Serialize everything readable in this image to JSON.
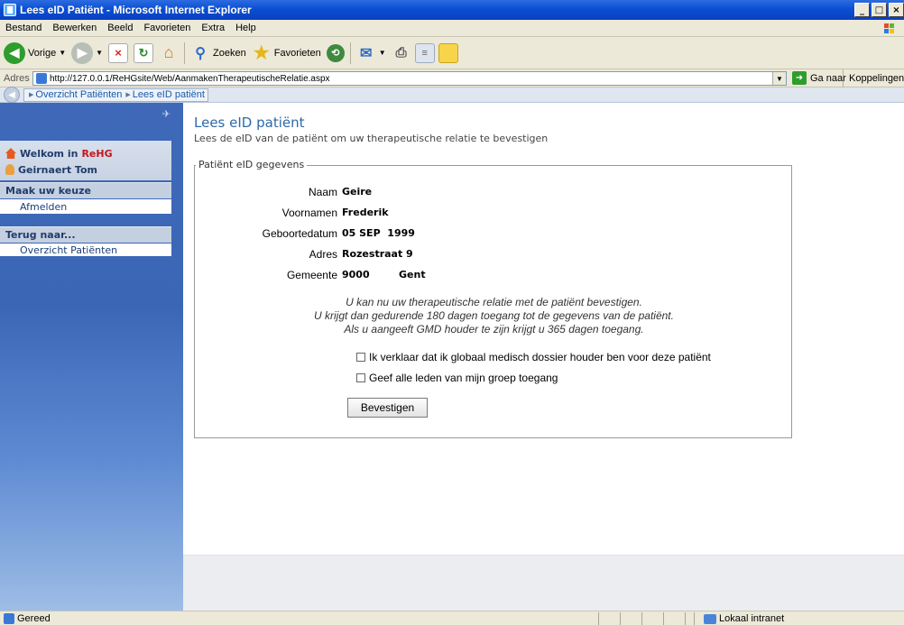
{
  "window": {
    "title": "Lees eID Patiënt - Microsoft Internet Explorer",
    "minimize": "_",
    "maximize": "□",
    "close": "×"
  },
  "menu": [
    "Bestand",
    "Bewerken",
    "Beeld",
    "Favorieten",
    "Extra",
    "Help"
  ],
  "toolbar": {
    "back_label": "Vorige",
    "search_label": "Zoeken",
    "favorites_label": "Favorieten"
  },
  "address": {
    "label": "Adres",
    "url": "http://127.0.0.1/ReHGsite/Web/AanmakenTherapeutischeRelatie.aspx",
    "go_label": "Ga naar",
    "links_label": "Koppelingen"
  },
  "breadcrumb": [
    "Overzicht Patiënten",
    "Lees eID patiënt"
  ],
  "sidebar": {
    "welcome_prefix": "Welkom in ",
    "welcome_app": "ReHG",
    "user": "Geirnaert Tom",
    "section1": "Maak uw keuze",
    "item_logout": "Afmelden",
    "section2": "Terug naar...",
    "item_patients": "Overzicht Patiënten"
  },
  "main": {
    "title": "Lees eID patiënt",
    "subtitle": "Lees de eID van de patiënt om uw therapeutische relatie te bevestigen",
    "fieldset_legend": "Patiënt eID gegevens",
    "fields": {
      "naam_label": "Naam",
      "naam_value": "Geire",
      "voornamen_label": "Voornamen",
      "voornamen_value": "Frederik",
      "geboorte_label": "Geboortedatum",
      "geboorte_value": "05 SEP  1999",
      "adres_label": "Adres",
      "adres_value": "Rozestraat 9",
      "gemeente_label": "Gemeente",
      "postcode_value": "9000",
      "gemeente_value": "Gent"
    },
    "info_line1": "U kan nu uw therapeutische relatie met de patiënt bevestigen.",
    "info_line2": "U krijgt dan gedurende 180 dagen toegang tot de gegevens van de patiënt.",
    "info_line3": "Als u aangeeft GMD houder te zijn krijgt u 365 dagen toegang.",
    "checkbox_gmd": "Ik verklaar dat ik globaal medisch dossier houder ben voor deze patiënt",
    "checkbox_group": "Geef alle leden van mijn groep toegang",
    "confirm_button": "Bevestigen"
  },
  "status": {
    "text": "Gereed",
    "zone": "Lokaal intranet"
  }
}
